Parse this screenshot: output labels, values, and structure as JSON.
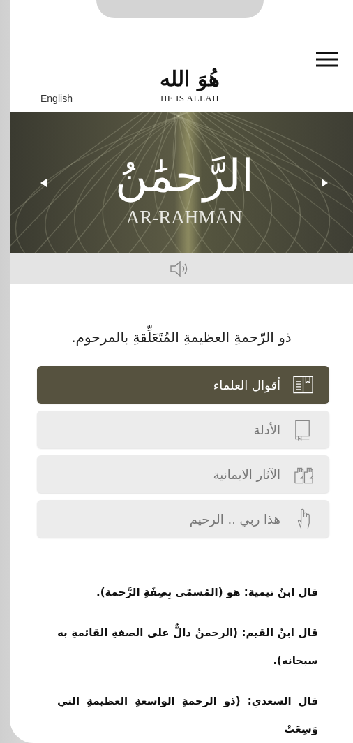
{
  "header": {
    "language_link": "English",
    "logo_text": "هُوَ الله",
    "logo_caption": "HE IS ALLAH"
  },
  "banner": {
    "name_arabic": "الرَّحمَٰنُ",
    "name_latin": "AR-RAHMĀN"
  },
  "description": "ذو الرّحمةِ العظيمةِ المُتَعَلِّقةِ بالمرحوم.",
  "menu": [
    {
      "label": "أقوال العلماء",
      "kind": "book-open",
      "selected": true
    },
    {
      "label": "الأدلة",
      "kind": "book",
      "selected": false
    },
    {
      "label": "الآثار الايمانية",
      "kind": "hands",
      "selected": false
    },
    {
      "label": "هذا ربي .. الرحيم",
      "kind": "hand",
      "selected": false
    }
  ],
  "quotes": [
    "قال ابنُ تيمية: هو (المُسمّى بِصِفَةِ الرَّحمة).",
    "قال ابنُ القيم: (الرحمنُ دالٌّ على الصفةِ القائمةِ به سبحانه).",
    "قال السعدي: (ذو الرحمةِ الواسعةِ العظيمةِ التي وَسِعَتْ"
  ]
}
